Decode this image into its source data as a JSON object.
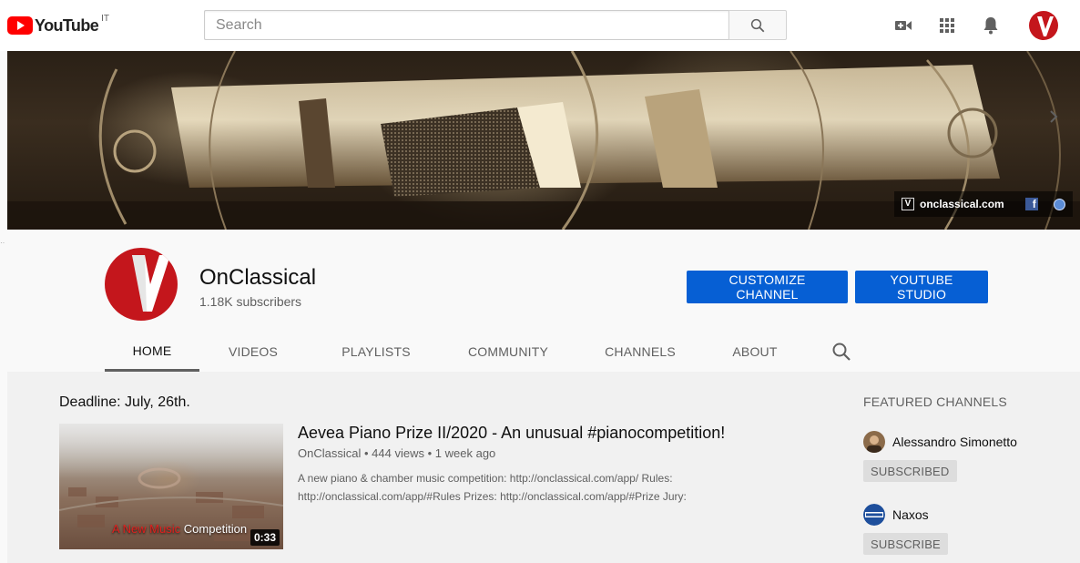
{
  "masthead": {
    "logo_text": "YouTube",
    "country_code": "IT",
    "search_placeholder": "Search",
    "icons": [
      "create-video-icon",
      "apps-grid-icon",
      "notifications-bell-icon"
    ]
  },
  "banner": {
    "site_link": "onclassical.com",
    "site_mark": "V",
    "facebook_glyph": "f"
  },
  "channel": {
    "name": "OnClassical",
    "subscribers": "1.18K subscribers",
    "customize_label": "CUSTOMIZE CHANNEL",
    "studio_label": "YOUTUBE STUDIO",
    "brand_color": "#c4161c",
    "button_color": "#065fd4"
  },
  "tabs": [
    {
      "label": "HOME",
      "active": true
    },
    {
      "label": "VIDEOS",
      "active": false
    },
    {
      "label": "PLAYLISTS",
      "active": false
    },
    {
      "label": "COMMUNITY",
      "active": false
    },
    {
      "label": "CHANNELS",
      "active": false
    },
    {
      "label": "ABOUT",
      "active": false
    }
  ],
  "shelf": {
    "title": "Deadline: July, 26th.",
    "video": {
      "title": "Aevea Piano Prize II/2020 - An unusual #pianocompetition!",
      "channel": "OnClassical",
      "views": "444 views",
      "age": "1 week ago",
      "separator": "•",
      "description_line1": "A new piano & chamber music competition: http://onclassical.com/app/ Rules:",
      "description_line2": "http://onclassical.com/app/#Rules Prizes: http://onclassical.com/app/#Prize Jury:",
      "duration": "0:33",
      "thumb_caption_red": "A New Music",
      "thumb_caption_white": "Competition"
    }
  },
  "featured": {
    "title": "FEATURED CHANNELS",
    "channels": [
      {
        "name": "Alessandro Simonetto",
        "button": "SUBSCRIBED"
      },
      {
        "name": "Naxos",
        "button": "SUBSCRIBE"
      }
    ]
  }
}
